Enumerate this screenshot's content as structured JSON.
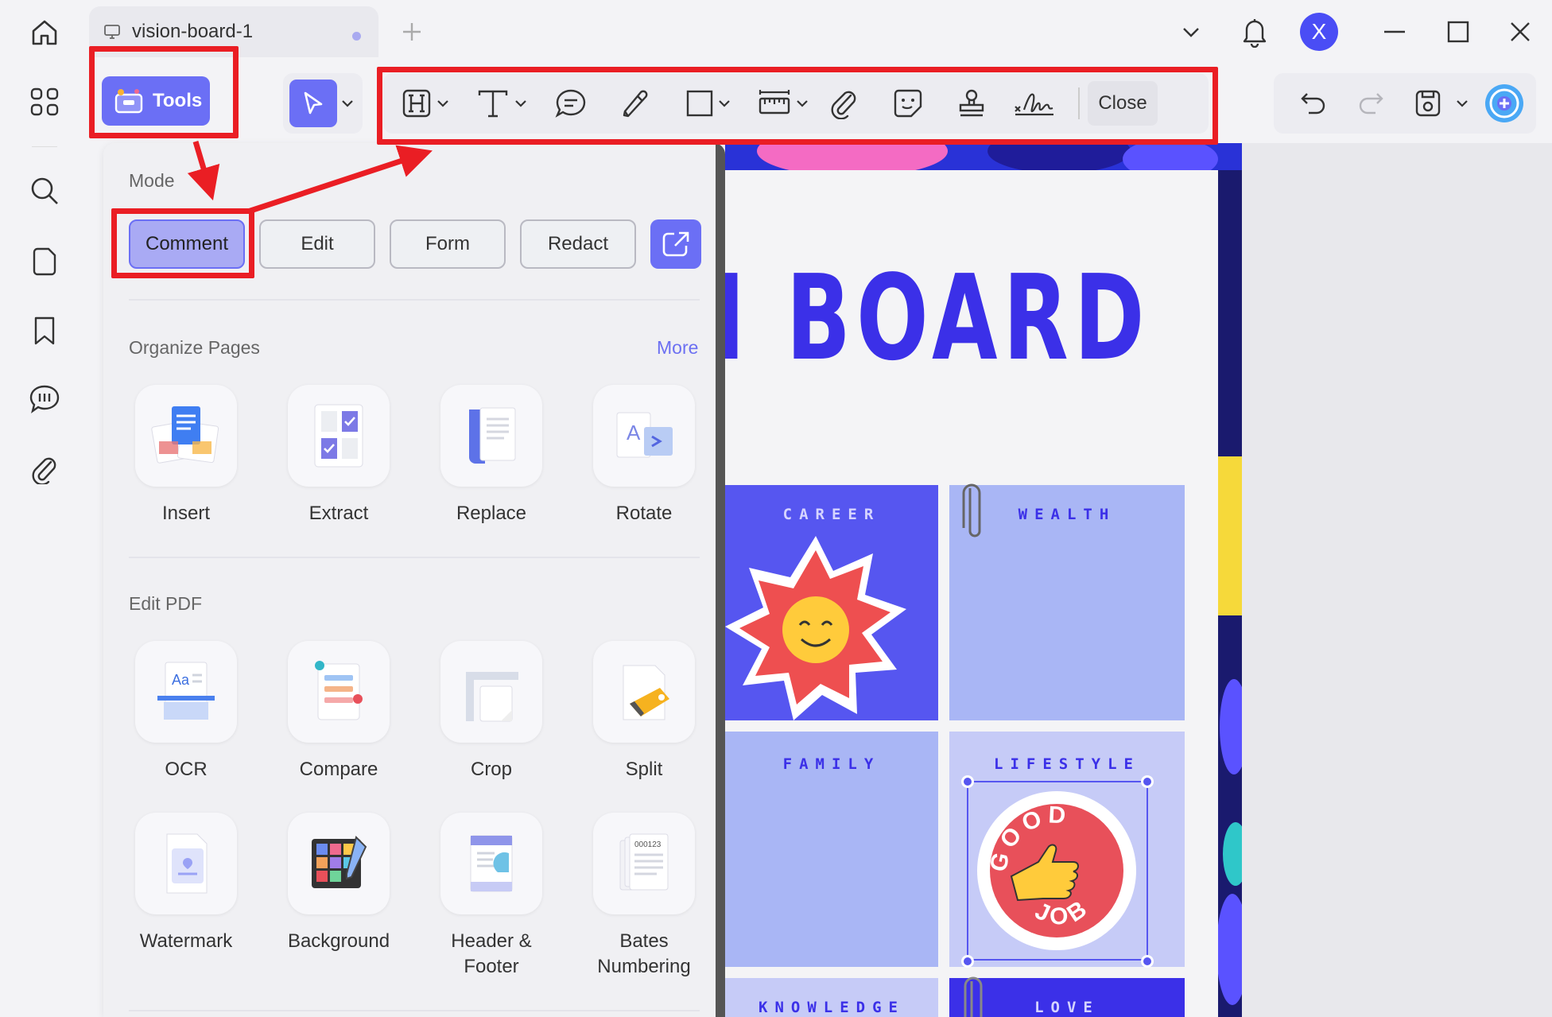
{
  "window": {
    "tab_title": "vision-board-1",
    "avatar_letter": "X"
  },
  "toolbar": {
    "tools_label": "Tools",
    "close_label": "Close"
  },
  "panel": {
    "mode_title": "Mode",
    "modes": [
      "Comment",
      "Edit",
      "Form",
      "Redact"
    ],
    "active_mode": "Comment",
    "organize_title": "Organize Pages",
    "more_label": "More",
    "organize_items": [
      "Insert",
      "Extract",
      "Replace",
      "Rotate"
    ],
    "edit_title": "Edit PDF",
    "edit_items": [
      "OCR",
      "Compare",
      "Crop",
      "Split",
      "Watermark",
      "Background",
      "Header &\nFooter",
      "Bates\nNumbering"
    ]
  },
  "document": {
    "title_visible": "N BOARD",
    "cells": [
      "CAREER",
      "WEALTH",
      "FAMILY",
      "LIFESTYLE",
      "KNOWLEDGE",
      "LOVE"
    ],
    "sticker_text_top": "GOOD",
    "sticker_text_bottom": "JOB"
  },
  "colors": {
    "accent": "#6b6ff5",
    "annotation_red": "#ea1e24",
    "board_blue": "#3b30e8"
  }
}
